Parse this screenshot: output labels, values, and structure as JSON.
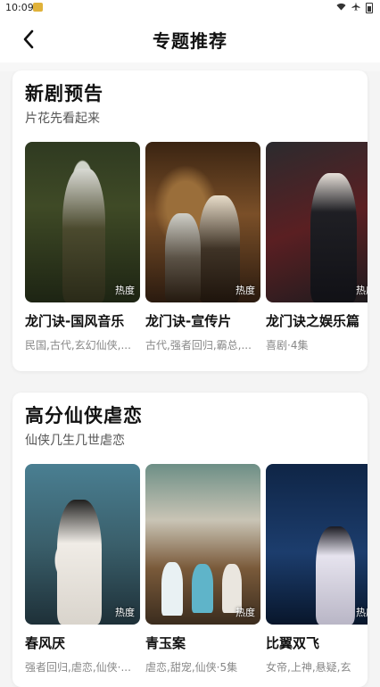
{
  "status": {
    "time": "10:09"
  },
  "header": {
    "title": "专题推荐",
    "back_icon": "chevron-left-icon"
  },
  "sections": [
    {
      "title": "新剧预告",
      "subtitle": "片花先看起来",
      "items": [
        {
          "title": "龙门诀-国风音乐",
          "tags": "民国,古代,玄幻仙侠,...",
          "heat": "热度"
        },
        {
          "title": "龙门诀-宣传片",
          "tags": "古代,强者回归,霸总,...",
          "heat": "热度"
        },
        {
          "title": "龙门诀之娱乐篇",
          "tags": "喜剧·4集",
          "heat": "热度"
        }
      ]
    },
    {
      "title": "高分仙侠虐恋",
      "subtitle": "仙侠几生几世虐恋",
      "items": [
        {
          "title": "春风厌",
          "tags": "强者回归,虐恋,仙侠·...",
          "heat": "热度"
        },
        {
          "title": "青玉案",
          "tags": "虐恋,甜宠,仙侠·5集",
          "heat": "热度"
        },
        {
          "title": "比翼双飞",
          "tags": "女帝,上神,悬疑,玄",
          "heat": "热度"
        }
      ]
    }
  ]
}
